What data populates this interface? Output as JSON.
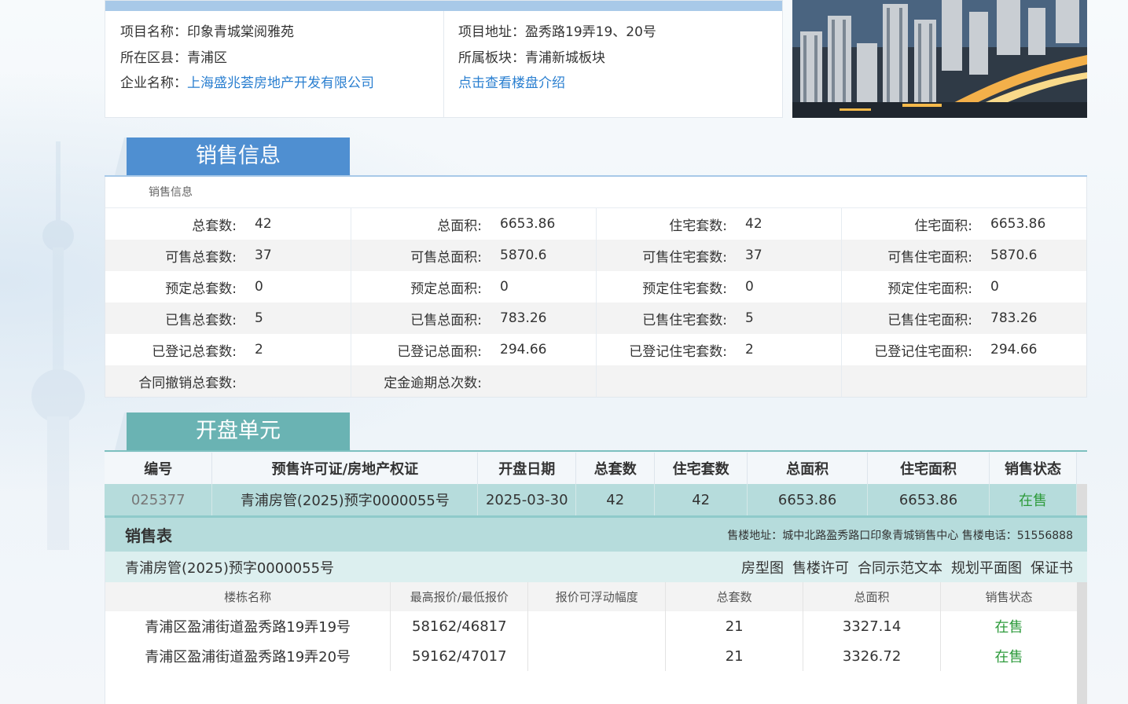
{
  "project": {
    "name_label": "项目名称：",
    "name": "印象青城棠阅雅苑",
    "district_label": "所在区县：",
    "district": "青浦区",
    "company_label": "企业名称：",
    "company": "上海盛兆荟房地产开发有限公司",
    "address_label": "项目地址：",
    "address": "盈秀路19弄19、20号",
    "block_label": "所属板块：",
    "block": "青浦新城板块",
    "intro_link": "点击查看楼盘介绍"
  },
  "sales_section": {
    "tab_title": "销售信息",
    "caption": "销售信息",
    "rows": [
      [
        {
          "k": "总套数:",
          "v": "42"
        },
        {
          "k": "总面积:",
          "v": "6653.86"
        },
        {
          "k": "住宅套数:",
          "v": "42"
        },
        {
          "k": "住宅面积:",
          "v": "6653.86"
        }
      ],
      [
        {
          "k": "可售总套数:",
          "v": "37"
        },
        {
          "k": "可售总面积:",
          "v": "5870.6"
        },
        {
          "k": "可售住宅套数:",
          "v": "37"
        },
        {
          "k": "可售住宅面积:",
          "v": "5870.6"
        }
      ],
      [
        {
          "k": "预定总套数:",
          "v": "0"
        },
        {
          "k": "预定总面积:",
          "v": "0"
        },
        {
          "k": "预定住宅套数:",
          "v": "0"
        },
        {
          "k": "预定住宅面积:",
          "v": "0"
        }
      ],
      [
        {
          "k": "已售总套数:",
          "v": "5"
        },
        {
          "k": "已售总面积:",
          "v": "783.26"
        },
        {
          "k": "已售住宅套数:",
          "v": "5"
        },
        {
          "k": "已售住宅面积:",
          "v": "783.26"
        }
      ],
      [
        {
          "k": "已登记总套数:",
          "v": "2"
        },
        {
          "k": "已登记总面积:",
          "v": "294.66"
        },
        {
          "k": "已登记住宅套数:",
          "v": "2"
        },
        {
          "k": "已登记住宅面积:",
          "v": "294.66"
        }
      ],
      [
        {
          "k": "合同撤销总套数:",
          "v": ""
        },
        {
          "k": "定金逾期总次数:",
          "v": ""
        },
        {
          "k": "",
          "v": ""
        },
        {
          "k": "",
          "v": ""
        }
      ]
    ]
  },
  "open_units": {
    "tab_title": "开盘单元",
    "headers": [
      "编号",
      "预售许可证/房地产权证",
      "开盘日期",
      "总套数",
      "住宅套数",
      "总面积",
      "住宅面积",
      "销售状态"
    ],
    "rows": [
      [
        "025377",
        "青浦房管(2025)预字0000055号",
        "2025-03-30",
        "42",
        "42",
        "6653.86",
        "6653.86",
        "在售"
      ]
    ]
  },
  "sales_table": {
    "title": "销售表",
    "info": "售楼地址：城中北路盈秀路口印象青城销售中心 售楼电话：51556888",
    "permit": "青浦房管(2025)预字0000055号",
    "links": [
      "房型图",
      "售楼许可",
      "合同示范文本",
      "规划平面图",
      "保证书"
    ],
    "headers": [
      "楼栋名称",
      "最高报价/最低报价",
      "报价可浮动幅度",
      "总套数",
      "总面积",
      "销售状态"
    ],
    "rows": [
      [
        "青浦区盈浦街道盈秀路19弄19号",
        "58162/46817",
        "",
        "21",
        "3327.14",
        "在售"
      ],
      [
        "青浦区盈浦街道盈秀路19弄20号",
        "59162/47017",
        "",
        "21",
        "3326.72",
        "在售"
      ]
    ]
  },
  "colors": {
    "link": "#2a7fd0",
    "on_sale": "#2e9b3c",
    "sales_tab": "#4f8fd1",
    "units_tab": "#6ab3b3"
  }
}
